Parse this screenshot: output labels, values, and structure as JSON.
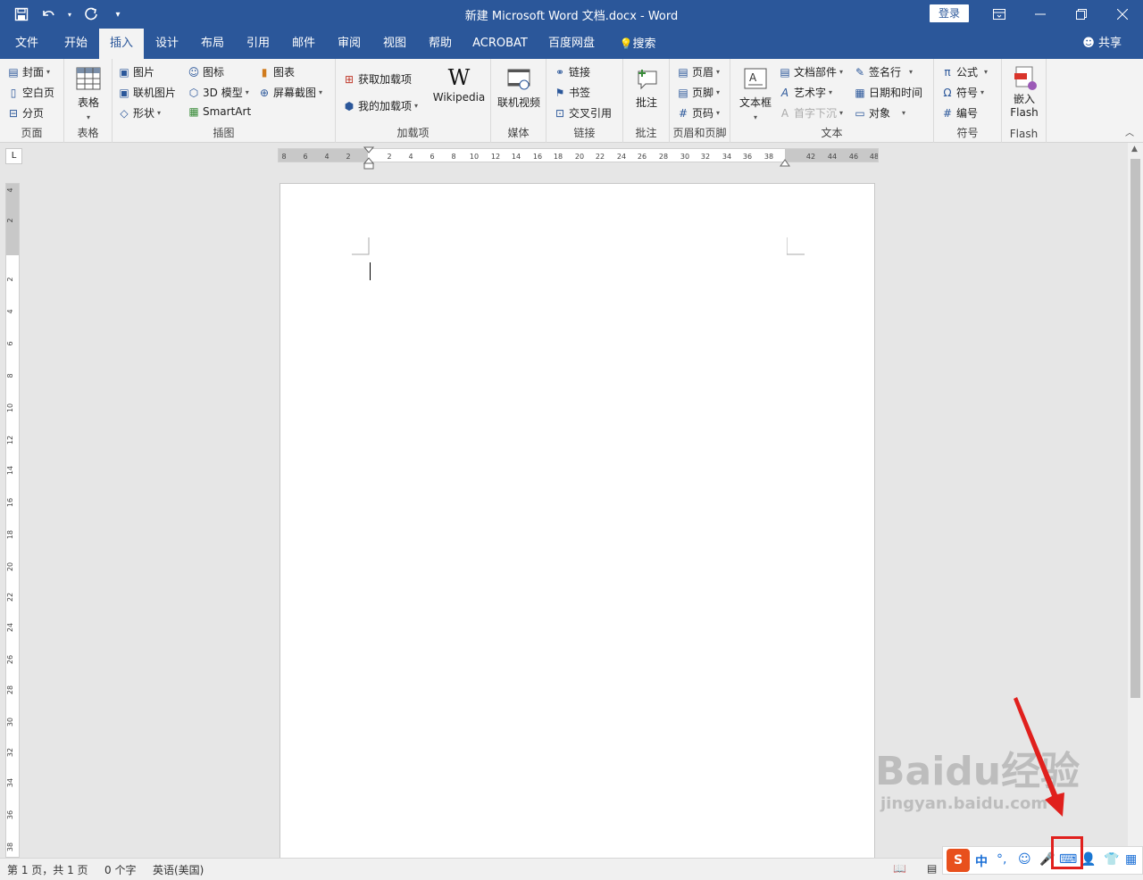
{
  "titlebar": {
    "title": "新建 Microsoft Word 文档.docx  -  Word",
    "login": "登录",
    "qat_save_icon": "save-icon",
    "qat_undo_icon": "undo-icon",
    "qat_redo_icon": "redo-icon"
  },
  "tabs": [
    {
      "label": "文件"
    },
    {
      "label": "开始"
    },
    {
      "label": "插入"
    },
    {
      "label": "设计"
    },
    {
      "label": "布局"
    },
    {
      "label": "引用"
    },
    {
      "label": "邮件"
    },
    {
      "label": "审阅"
    },
    {
      "label": "视图"
    },
    {
      "label": "帮助"
    },
    {
      "label": "ACROBAT"
    },
    {
      "label": "百度网盘"
    },
    {
      "label": "搜索"
    }
  ],
  "share": "共享",
  "ribbon": {
    "pages": {
      "cover": "封面",
      "blank": "空白页",
      "break": "分页",
      "label": "页面"
    },
    "tables": {
      "table": "表格",
      "label": "表格"
    },
    "illustrations": {
      "picture": "图片",
      "online_picture": "联机图片",
      "shapes": "形状",
      "icons": "图标",
      "model3d": "3D 模型",
      "smartart": "SmartArt",
      "chart": "图表",
      "screenshot": "屏幕截图",
      "label": "插图"
    },
    "addins": {
      "get": "获取加载项",
      "mine": "我的加载项",
      "wikipedia": "Wikipedia",
      "label": "加载项"
    },
    "media": {
      "online_video": "联机视频",
      "label": "媒体"
    },
    "links": {
      "link": "链接",
      "bookmark": "书签",
      "crossref": "交叉引用",
      "label": "链接"
    },
    "comments": {
      "comment": "批注",
      "label": "批注"
    },
    "header_footer": {
      "header": "页眉",
      "footer": "页脚",
      "page_number": "页码",
      "label": "页眉和页脚"
    },
    "text": {
      "textbox": "文本框",
      "quickparts": "文档部件",
      "wordart": "艺术字",
      "dropcap": "首字下沉",
      "signature": "签名行",
      "datetime": "日期和时间",
      "object": "对象",
      "label": "文本"
    },
    "symbols": {
      "equation": "公式",
      "symbol": "符号",
      "number": "编号",
      "label": "符号"
    },
    "flash": {
      "embed": "嵌入",
      "flash": "Flash",
      "label": "Flash"
    }
  },
  "ruler": {
    "h_ticks": [
      "8",
      "6",
      "4",
      "2",
      "2",
      "4",
      "6",
      "8",
      "10",
      "12",
      "14",
      "16",
      "18",
      "20",
      "22",
      "24",
      "26",
      "28",
      "30",
      "32",
      "34",
      "36",
      "38",
      "42",
      "44",
      "46",
      "48"
    ],
    "v_ticks": [
      "4",
      "2",
      "2",
      "4",
      "6",
      "8",
      "10",
      "12",
      "14",
      "16",
      "18",
      "20",
      "22",
      "24",
      "26",
      "28",
      "30",
      "32",
      "34",
      "36",
      "38"
    ]
  },
  "status": {
    "page": "第 1 页，共 1 页",
    "words": "0 个字",
    "language": "英语(美国)"
  },
  "ime": {
    "mode": "中"
  },
  "watermark": {
    "text": "Baidu经验",
    "url": "jingyan.baidu.com"
  }
}
